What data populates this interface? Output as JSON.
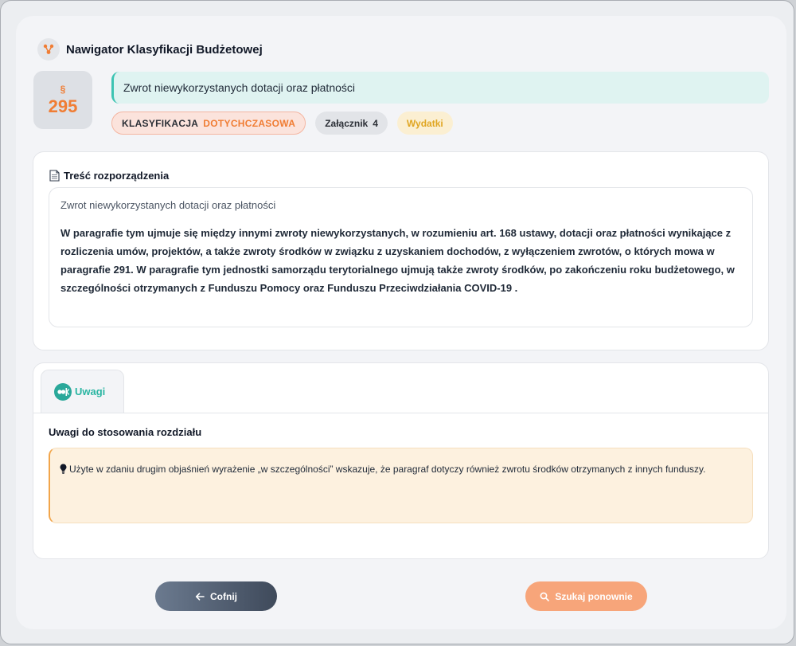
{
  "header": {
    "title": "Nawigator Klasyfikacji Budżetowej",
    "logo_icon": "network-icon"
  },
  "code": {
    "symbol": "§",
    "number": "295"
  },
  "item": {
    "title": "Zwrot niewykorzystanych dotacji oraz płatności"
  },
  "badges": {
    "classification_label": "KLASYFIKACJA",
    "classification_value": "DOTYCHCZASOWA",
    "attachment_label": "Załącznik",
    "attachment_value": "4",
    "type_label": "Wydatki"
  },
  "regulation": {
    "section_title": "Treść rozporządzenia",
    "subtitle": "Zwrot niewykorzystanych dotacji oraz płatności",
    "body": "W  paragrafie tym ujmuje się między innymi zwroty niewykorzystanych, w  rozumieniu art. 168 ustawy, dotacji oraz płatności wynikające z rozliczenia umów, projektów, a także zwroty środków w związku z uzyskaniem dochodów, z wyłączeniem zwrotów, o których mowa w paragrafie 291. W paragrafie tym jednostki samorządu terytorialnego ujmują także zwroty środków, po zakończeniu roku budżetowego, w szczególności otrzymanych z Funduszu Pomocy oraz Funduszu Przeciwdziałania COVID-19 ."
  },
  "notes": {
    "tab_label": "Uwagi",
    "title": "Uwagi do stosowania rozdziału",
    "text": "Użyte w zdaniu drugim objaśnień wyrażenie „w szczególności” wskazuje, że paragraf dotyczy również zwrotu środków otrzymanych z innych funduszy."
  },
  "buttons": {
    "back_label": "Cofnij",
    "search_label": "Szukaj ponownie"
  },
  "colors": {
    "accent_orange": "#f07d34",
    "accent_teal": "#3cc4b3",
    "button_dark": "#4b5567",
    "button_orange": "#f7a57a"
  }
}
